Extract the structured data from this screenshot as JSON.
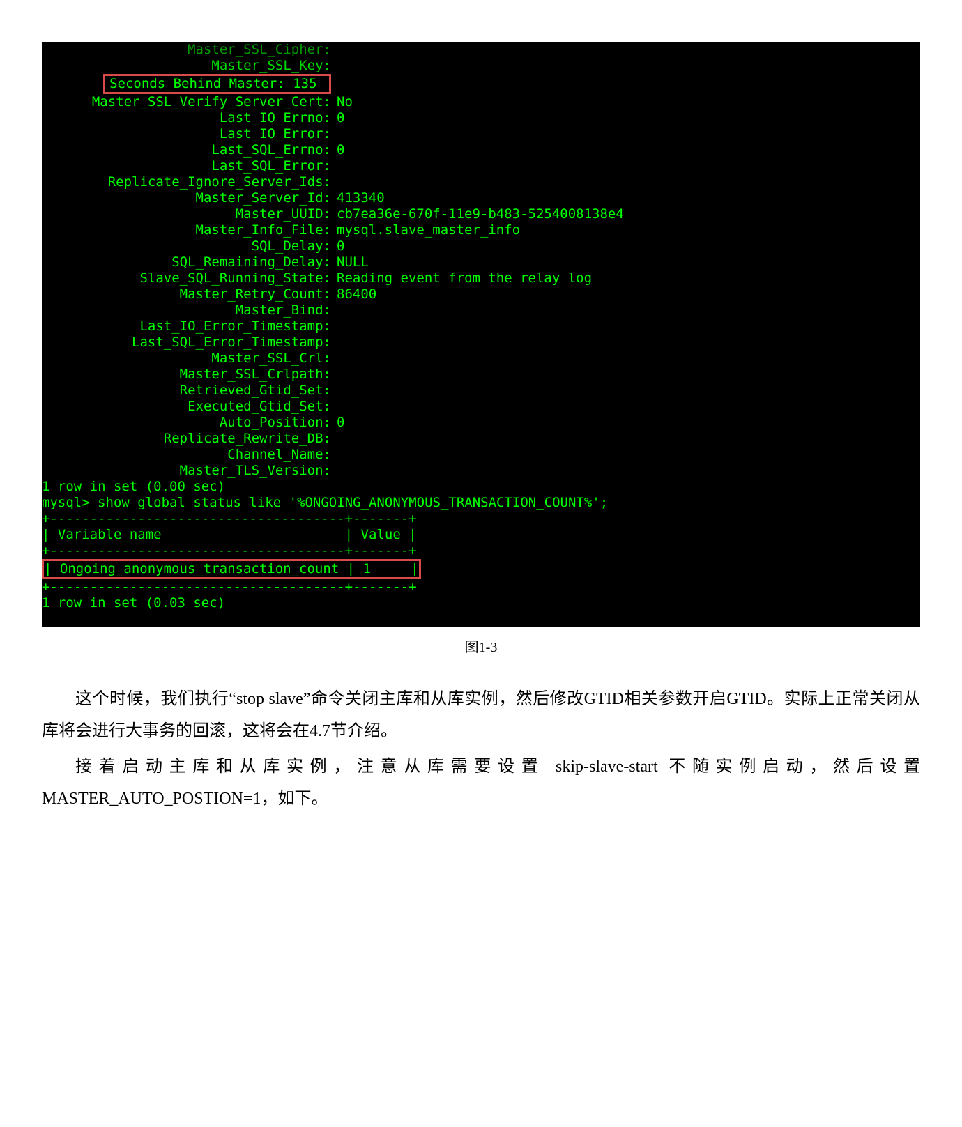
{
  "terminal": {
    "top_partial1": "Master_SSL_Cipher:",
    "top_partial2": "Master_SSL_Key:",
    "highlighted_row": {
      "label": "Seconds_Behind_Master:",
      "value": "135"
    },
    "rows": [
      {
        "label": "Master_SSL_Verify_Server_Cert:",
        "value": "No"
      },
      {
        "label": "Last_IO_Errno:",
        "value": "0"
      },
      {
        "label": "Last_IO_Error:",
        "value": ""
      },
      {
        "label": "Last_SQL_Errno:",
        "value": "0"
      },
      {
        "label": "Last_SQL_Error:",
        "value": ""
      },
      {
        "label": "Replicate_Ignore_Server_Ids:",
        "value": ""
      },
      {
        "label": "Master_Server_Id:",
        "value": "413340"
      },
      {
        "label": "Master_UUID:",
        "value": "cb7ea36e-670f-11e9-b483-5254008138e4"
      },
      {
        "label": "Master_Info_File:",
        "value": "mysql.slave_master_info"
      },
      {
        "label": "SQL_Delay:",
        "value": "0"
      },
      {
        "label": "SQL_Remaining_Delay:",
        "value": "NULL"
      },
      {
        "label": "Slave_SQL_Running_State:",
        "value": "Reading event from the relay log"
      },
      {
        "label": "Master_Retry_Count:",
        "value": "86400"
      },
      {
        "label": "Master_Bind:",
        "value": ""
      },
      {
        "label": "Last_IO_Error_Timestamp:",
        "value": ""
      },
      {
        "label": "Last_SQL_Error_Timestamp:",
        "value": ""
      },
      {
        "label": "Master_SSL_Crl:",
        "value": ""
      },
      {
        "label": "Master_SSL_Crlpath:",
        "value": ""
      },
      {
        "label": "Retrieved_Gtid_Set:",
        "value": ""
      },
      {
        "label": "Executed_Gtid_Set:",
        "value": ""
      },
      {
        "label": "Auto_Position:",
        "value": "0"
      },
      {
        "label": "Replicate_Rewrite_DB:",
        "value": ""
      },
      {
        "label": "Channel_Name:",
        "value": ""
      },
      {
        "label": "Master_TLS_Version:",
        "value": ""
      }
    ],
    "footer1": "1 row in set (0.00 sec)",
    "blank": "",
    "query": "mysql> show global status like '%ONGOING_ANONYMOUS_TRANSACTION_COUNT%';",
    "tbl_top": "+-------------------------------------+-------+",
    "tbl_header": "| Variable_name                       | Value |",
    "tbl_mid": "+-------------------------------------+-------+",
    "tbl_row": "| Ongoing_anonymous_transaction_count | 1     |",
    "tbl_bot": "+-------------------------------------+-------+",
    "footer2": "1 row in set (0.03 sec)"
  },
  "caption": "图1-3",
  "para1": "这个时候，我们执行“stop  slave”命令关闭主库和从库实例，然后修改GTID相关参数开启GTID。实际上正常关闭从库将会进行大事务的回滚，这将会在4.7节介绍。",
  "para2": "接着启动主库和从库实例，注意从库需要设置 skip-slave-start 不随实例启动，然后设置MASTER_AUTO_POSTION=1，如下。"
}
